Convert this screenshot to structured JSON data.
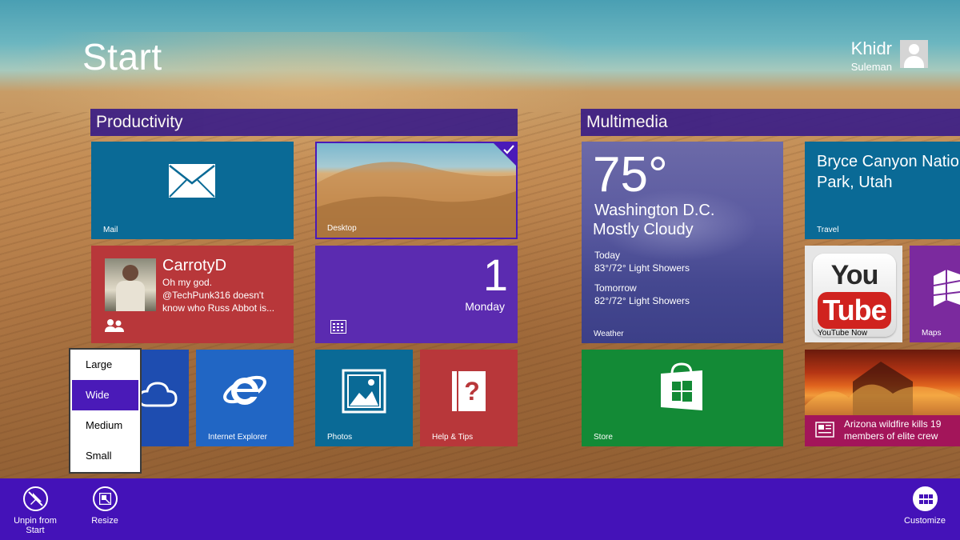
{
  "screen_title": "Start",
  "user": {
    "first_name": "Khidr",
    "last_name": "Suleman"
  },
  "groups": {
    "productivity": "Productivity",
    "multimedia": "Multimedia"
  },
  "tiles": {
    "mail": {
      "label": "Mail",
      "icon": "mail-icon",
      "color": "#0a6a96"
    },
    "desktop": {
      "label": "Desktop",
      "selected": true
    },
    "people": {
      "name": "CarrotyD",
      "message": "Oh my god. @TechPunk316 doesn't know who Russ Abbot is...",
      "icon": "people-icon",
      "color": "#b8373a"
    },
    "calendar": {
      "day_number": "1",
      "day_name": "Monday",
      "icon": "calendar-icon",
      "color": "#5b2bb0"
    },
    "onedrive": {
      "icon": "cloud-icon",
      "color": "#1e4db0"
    },
    "ie": {
      "label": "Internet Explorer",
      "icon": "ie-icon",
      "color": "#2166c4"
    },
    "photos": {
      "label": "Photos",
      "icon": "photos-icon",
      "color": "#0a6a96"
    },
    "help": {
      "label": "Help & Tips",
      "icon": "help-icon",
      "color": "#b8373a"
    },
    "weather": {
      "label": "Weather",
      "temperature": "75°",
      "city": "Washington D.C.",
      "condition": "Mostly Cloudy",
      "today_label": "Today",
      "today_forecast": "83°/72° Light Showers",
      "tomorrow_label": "Tomorrow",
      "tomorrow_forecast": "82°/72° Light Showers"
    },
    "travel": {
      "label": "Travel",
      "headline": "Bryce Canyon National Park, Utah",
      "color": "#0a6a96"
    },
    "youtube": {
      "label": "YouTube Now",
      "logo_top": "You",
      "logo_bottom": "Tube"
    },
    "maps": {
      "label": "Maps",
      "icon": "maps-icon",
      "color": "#7b2a9e"
    },
    "store": {
      "label": "Store",
      "icon": "store-icon",
      "color": "#138a36"
    },
    "news": {
      "headline": "Arizona wildfire kills 19 members of elite crew",
      "icon": "news-icon",
      "color": "#a3155a"
    }
  },
  "resize_menu": {
    "options": [
      "Large",
      "Wide",
      "Medium",
      "Small"
    ],
    "selected": "Wide"
  },
  "app_bar": {
    "unpin_label": "Unpin from Start",
    "resize_label": "Resize",
    "customize_label": "Customize"
  }
}
